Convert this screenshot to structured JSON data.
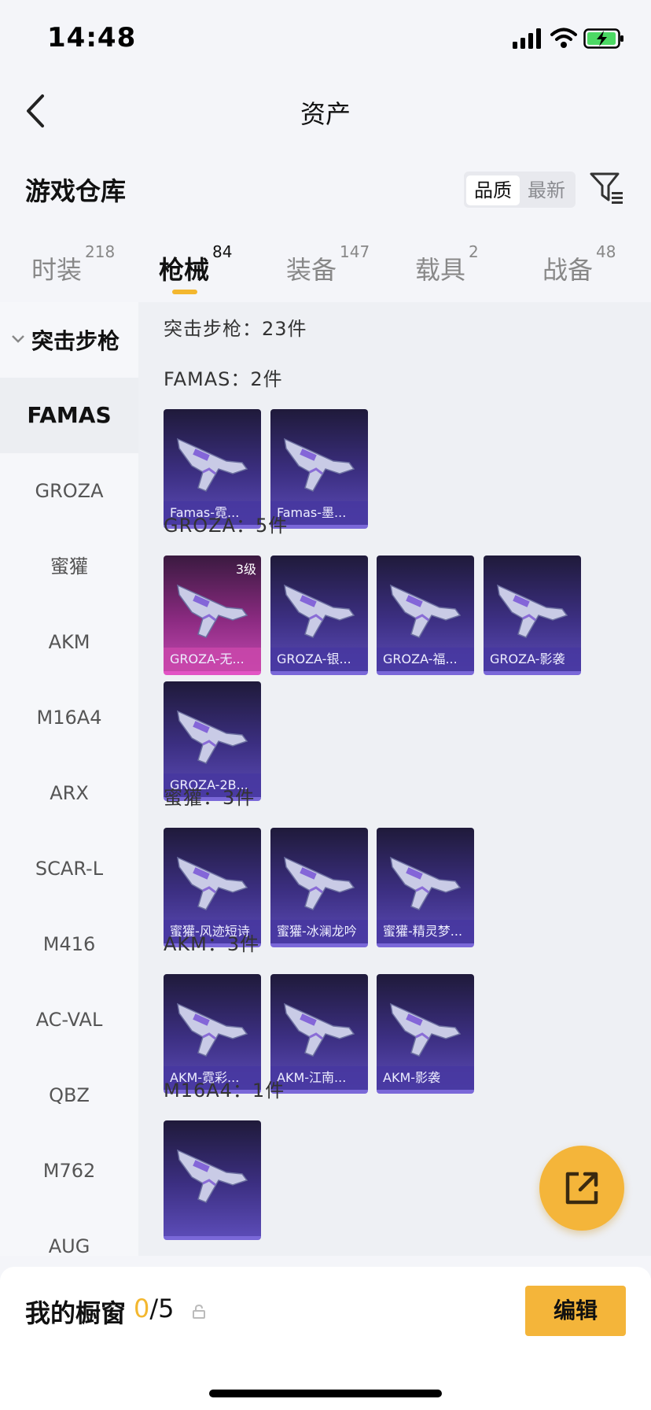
{
  "status_bar": {
    "time": "14:48"
  },
  "nav": {
    "title": "资产"
  },
  "warehouse": {
    "title": "游戏仓库",
    "sort_options": [
      "品质",
      "最新"
    ]
  },
  "tabs": [
    {
      "label": "时装",
      "count": "218"
    },
    {
      "label": "枪械",
      "count": "84"
    },
    {
      "label": "装备",
      "count": "147"
    },
    {
      "label": "载具",
      "count": "2"
    },
    {
      "label": "战备",
      "count": "48"
    }
  ],
  "sidebar": {
    "category": "突击步枪",
    "items": [
      "FAMAS",
      "GROZA",
      "蜜獾",
      "AKM",
      "M16A4",
      "ARX",
      "SCAR-L",
      "M416",
      "AC-VAL",
      "QBZ",
      "M762",
      "AUG"
    ],
    "selected": "FAMAS"
  },
  "main": {
    "summary": "突击步枪：23件",
    "groups": [
      {
        "title": "FAMAS：2件",
        "items": [
          {
            "name": "Famas-霓..."
          },
          {
            "name": "Famas-墨..."
          }
        ]
      },
      {
        "title": "GROZA：5件",
        "items": [
          {
            "name": "GROZA-无...",
            "level": "3级",
            "pink": true
          },
          {
            "name": "GROZA-银..."
          },
          {
            "name": "GROZA-福..."
          },
          {
            "name": "GROZA-影袭"
          },
          {
            "name": "GROZA-2B..."
          }
        ]
      },
      {
        "title": "蜜獾：3件",
        "items": [
          {
            "name": "蜜獾-风迹短诗"
          },
          {
            "name": "蜜獾-冰澜龙吟"
          },
          {
            "name": "蜜獾-精灵梦..."
          }
        ]
      },
      {
        "title": "AKM：3件",
        "items": [
          {
            "name": "AKM-霓彩..."
          },
          {
            "name": "AKM-江南..."
          },
          {
            "name": "AKM-影袭"
          }
        ]
      },
      {
        "title": "M16A4：1件",
        "items": [
          {
            "name": ""
          }
        ]
      }
    ]
  },
  "bottom": {
    "showcase_label": "我的橱窗",
    "count_current": "0",
    "count_total": "/5",
    "edit_label": "编辑"
  },
  "colors": {
    "accent": "#f3b72f",
    "card_purple": "#3c2f82",
    "card_pink": "#c348b0"
  }
}
